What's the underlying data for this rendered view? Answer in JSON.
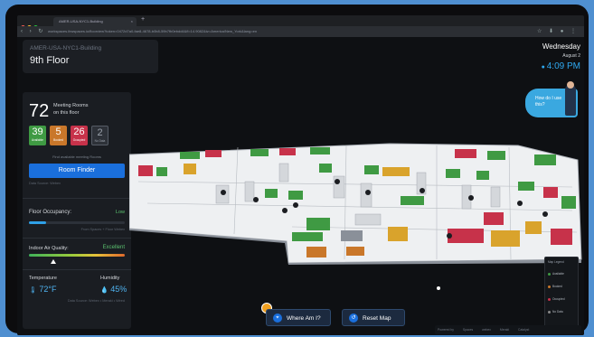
{
  "browser": {
    "tab_title": "AMER-USA-NYC1-Building",
    "tab_close": "×",
    "new_tab": "+",
    "url": "workspaces.ihwspaces.io/floorview?token=0472d7a0-fae8-4678-b0b8-59b7fb0ebdd4&fl=14.9082&tz=America/New_York&lang=en",
    "nav_icons": "‹ › ↻",
    "toolbar_icons": "☆ ⬇ ● ⋮",
    "traffic_colors": [
      "#ff5f56",
      "#ffbd2e",
      "#27c93f"
    ]
  },
  "header": {
    "building": "AMER-USA-NYC1-Building",
    "floor": "9th Floor"
  },
  "clock": {
    "day": "Wednesday",
    "date": "August 2",
    "time": "4:09 PM"
  },
  "rooms": {
    "total": "72",
    "label_line1": "Meeting Rooms",
    "label_line2": "on this floor",
    "stats": [
      {
        "value": "39",
        "label": "Available",
        "color": "#3f9a43"
      },
      {
        "value": "5",
        "label": "Booked",
        "color": "#c9772a"
      },
      {
        "value": "26",
        "label": "Occupied",
        "color": "#c7324a"
      },
      {
        "value": "2",
        "label": "No Data",
        "color": "#2d3138"
      }
    ],
    "hint": "Find available meeting Rooms",
    "finder_button": "Room Finder",
    "source": "Data Source: Webex"
  },
  "occupancy": {
    "label": "Floor Occupancy:",
    "value": "Low",
    "fraction": 0.18,
    "source": "From Spaces + Floor Webex"
  },
  "air_quality": {
    "label": "Indoor Air Quality:",
    "value": "Excellent",
    "temperature_label": "Temperature",
    "temperature": "72°F",
    "humidity_label": "Humidity",
    "humidity": "45%",
    "source": "Data Source: Webex • Meraki • Wired"
  },
  "help": {
    "text": "How do I use this?"
  },
  "legend": {
    "title": "Map Legend",
    "items": [
      {
        "label": "Available",
        "color": "#3f9a43"
      },
      {
        "label": "Booked",
        "color": "#c9772a"
      },
      {
        "label": "Occupied",
        "color": "#c7324a"
      },
      {
        "label": "No Data",
        "color": "#888888"
      }
    ]
  },
  "actions": {
    "where_am_i": "Where Am I?",
    "reset_map": "Reset Map"
  },
  "powered": {
    "label": "Powered by",
    "partners": [
      "Spaces",
      "webex",
      "Meraki",
      "Catalyst"
    ]
  },
  "map": {
    "floor_color": "#eef0f2",
    "wall_color": "#aeb3ba",
    "room_colors": {
      "available": "#3f9a43",
      "booked": "#c9772a",
      "occupied": "#c7324a",
      "desk": "#d9a32c"
    }
  }
}
